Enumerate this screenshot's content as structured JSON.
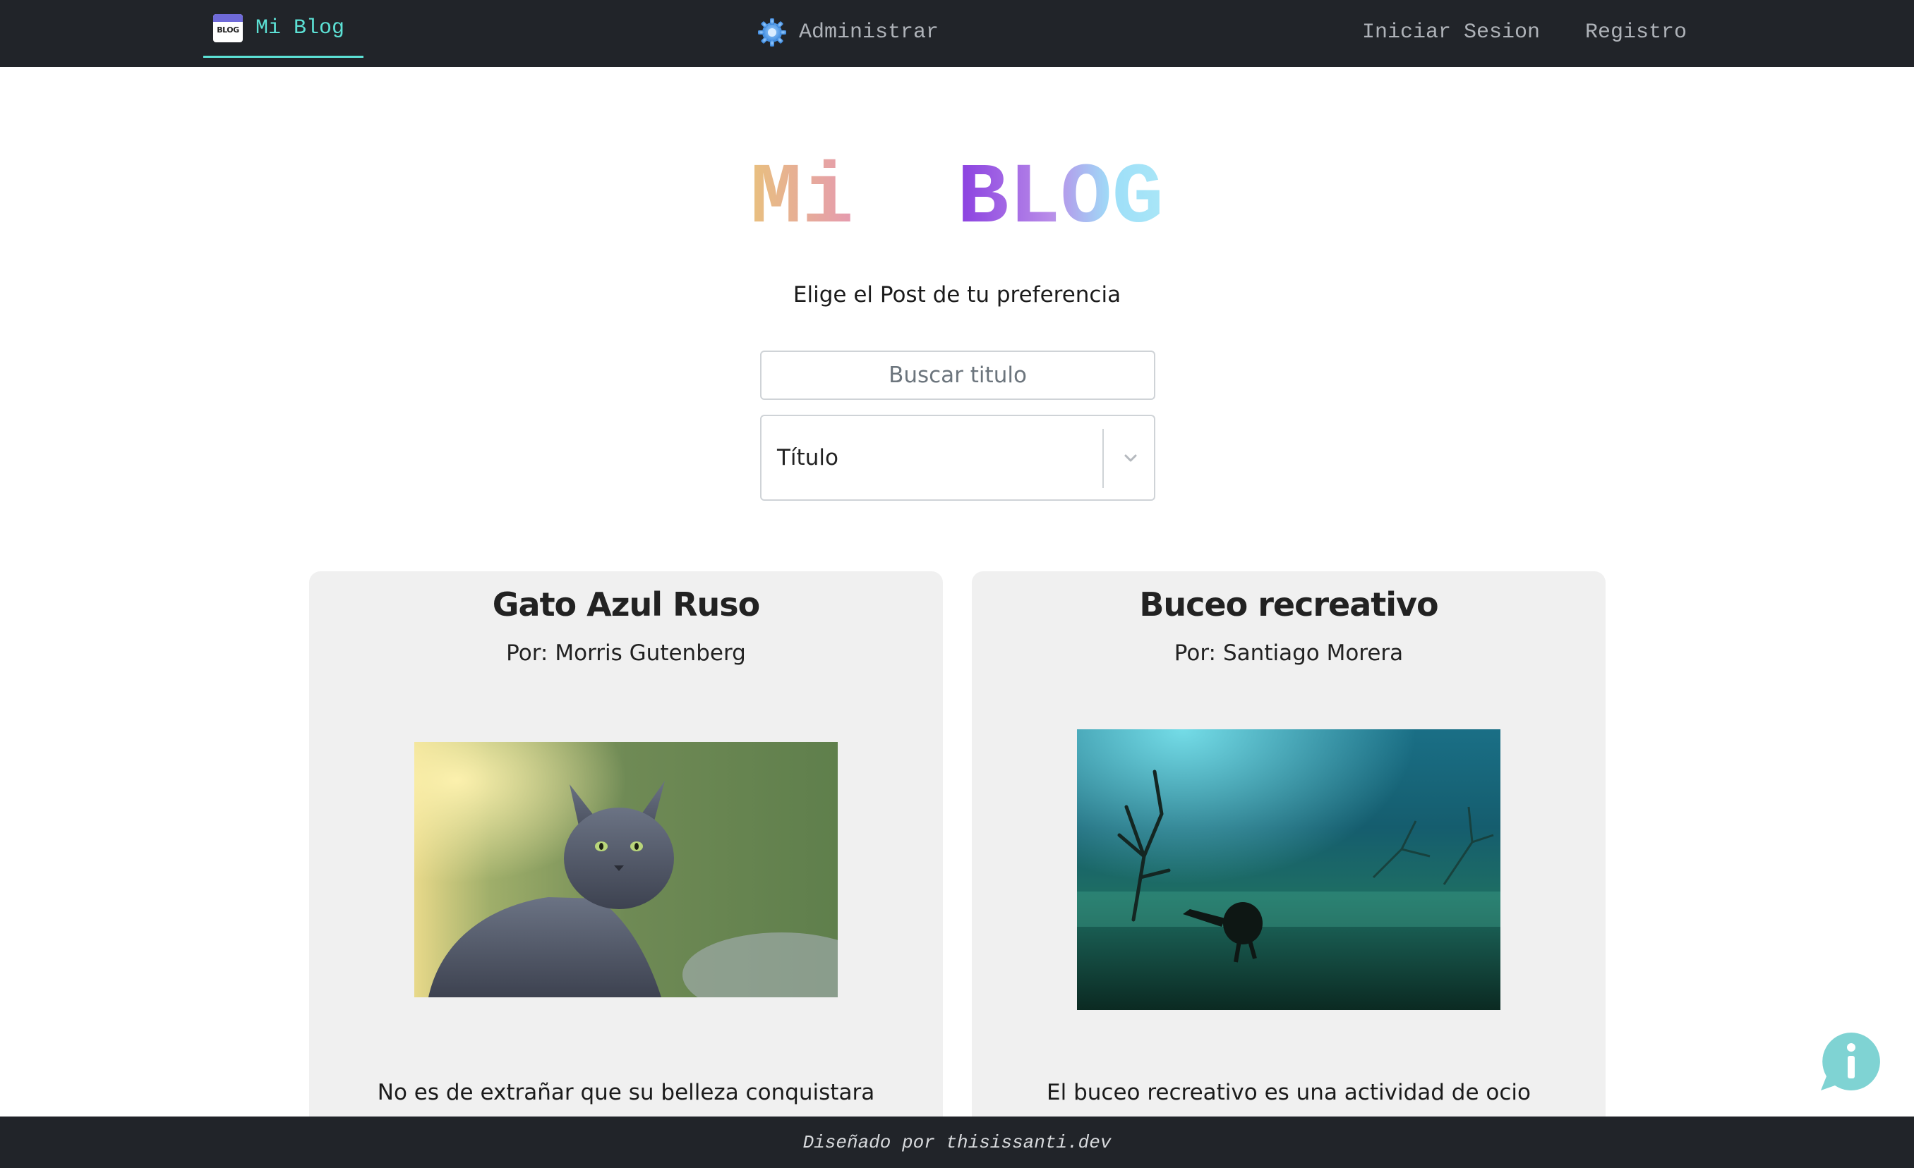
{
  "navbar": {
    "brand_logo_text": "BLOG",
    "brand_label": "Mi Blog",
    "admin_label": "Administrar",
    "admin_icon": "gear-icon",
    "login_label": "Iniciar Sesion",
    "register_label": "Registro",
    "background_color": "#212429",
    "accent_color": "#5ce1d5"
  },
  "hero": {
    "title_word1": "Mi",
    "title_word2": "BLOG",
    "subtitle": "Elige el Post de tu preferencia"
  },
  "filters": {
    "search_placeholder": "Buscar titulo",
    "search_value": "",
    "sort_selected": "Título",
    "sort_icon": "chevron-down-icon"
  },
  "posts": [
    {
      "title": "Gato Azul Ruso",
      "author_prefix": "Por:",
      "author": "Morris Gutenberg",
      "image": "gray cat photo",
      "excerpt": "No es de extrañar que su belleza conquistara"
    },
    {
      "title": "Buceo recreativo",
      "author_prefix": "Por:",
      "author": "Santiago Morera",
      "image": "underwater diver photo",
      "excerpt": "El buceo recreativo es una actividad de ocio"
    }
  ],
  "footer": {
    "credit": "Diseñado por thisissanti.dev"
  },
  "info_button": {
    "icon": "info-chat-icon",
    "color": "#7fd3d3"
  }
}
